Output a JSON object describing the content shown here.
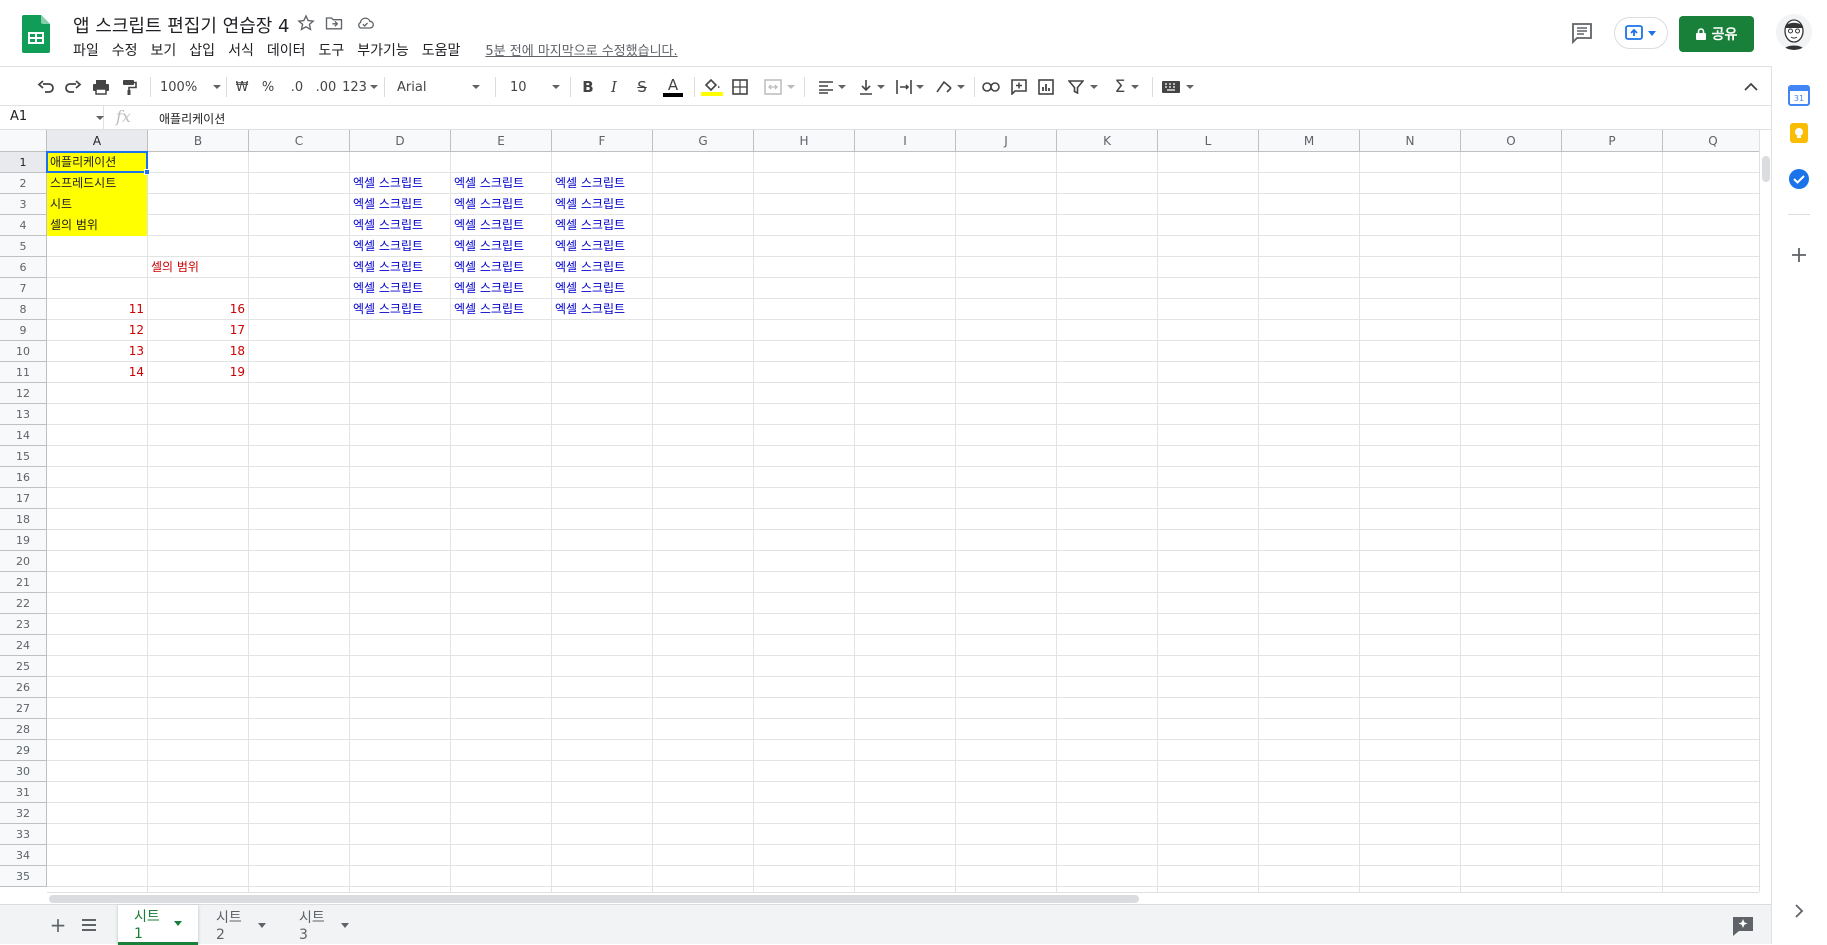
{
  "app": {
    "title": "앱 스크립트 편집기 연습장 4",
    "menu": [
      "파일",
      "수정",
      "보기",
      "삽입",
      "서식",
      "데이터",
      "도구",
      "부가기능",
      "도움말"
    ],
    "last_edit": "5분 전에 마지막으로 수정했습니다.",
    "share_label": "공유",
    "colors": {
      "accent_green": "#188038",
      "sheets_green": "#0f9d58",
      "selection_blue": "#1a73e8"
    }
  },
  "toolbar": {
    "zoom": "100%",
    "currency": "₩",
    "percent": "%",
    "dec_decrease": ".0",
    "dec_increase": ".00",
    "format_more": "123",
    "font": "Arial",
    "font_size": "10",
    "icons": [
      "undo-icon",
      "redo-icon",
      "print-icon",
      "paint-format-icon",
      "bold-icon",
      "italic-icon",
      "strikethrough-icon",
      "text-color-icon",
      "fill-color-icon",
      "borders-icon",
      "merge-icon",
      "align-icon",
      "valign-icon",
      "wrap-icon",
      "rotate-icon",
      "link-icon",
      "comment-icon",
      "chart-icon",
      "filter-icon",
      "functions-icon",
      "input-tools-icon",
      "collapse-icon"
    ]
  },
  "formula_bar": {
    "cell_ref": "A1",
    "fx": "fx",
    "value": "애플리케이션"
  },
  "grid": {
    "columns": [
      "A",
      "B",
      "C",
      "D",
      "E",
      "F",
      "G",
      "H",
      "I",
      "J",
      "K",
      "L",
      "M",
      "N",
      "O",
      "P",
      "Q"
    ],
    "rows": [
      "1",
      "2",
      "3",
      "4",
      "5",
      "6",
      "7",
      "8",
      "9",
      "10",
      "11",
      "12",
      "13",
      "14",
      "15",
      "16",
      "17",
      "18",
      "19",
      "20",
      "21",
      "22",
      "23",
      "24",
      "25",
      "26",
      "27",
      "28",
      "29",
      "30",
      "31",
      "32",
      "33",
      "34",
      "35"
    ],
    "cells": {
      "A1": "애플리케이션",
      "A2": "스프레드시트",
      "A3": "시트",
      "A4": "셀의 범위",
      "B6": "셀의 범위",
      "A8": "11",
      "A9": "12",
      "A10": "13",
      "A11": "14",
      "B8": "16",
      "B9": "17",
      "B10": "18",
      "B11": "19",
      "D2": "엑셀 스크립트",
      "E2": "엑셀 스크립트",
      "F2": "엑셀 스크립트",
      "D3": "엑셀 스크립트",
      "E3": "엑셀 스크립트",
      "F3": "엑셀 스크립트",
      "D4": "엑셀 스크립트",
      "E4": "엑셀 스크립트",
      "F4": "엑셀 스크립트",
      "D5": "엑셀 스크립트",
      "E5": "엑셀 스크립트",
      "F5": "엑셀 스크립트",
      "D6": "엑셀 스크립트",
      "E6": "엑셀 스크립트",
      "F6": "엑셀 스크립트",
      "D7": "엑셀 스크립트",
      "E7": "엑셀 스크립트",
      "F7": "엑셀 스크립트",
      "D8": "엑셀 스크립트",
      "E8": "엑셀 스크립트",
      "F8": "엑셀 스크립트"
    }
  },
  "sheets": {
    "tabs": [
      "시트1",
      "시트2",
      "시트3"
    ],
    "active": "시트1"
  },
  "side_panel": [
    "calendar-icon",
    "keep-icon",
    "tasks-icon",
    "add-icon",
    "expand-icon"
  ]
}
